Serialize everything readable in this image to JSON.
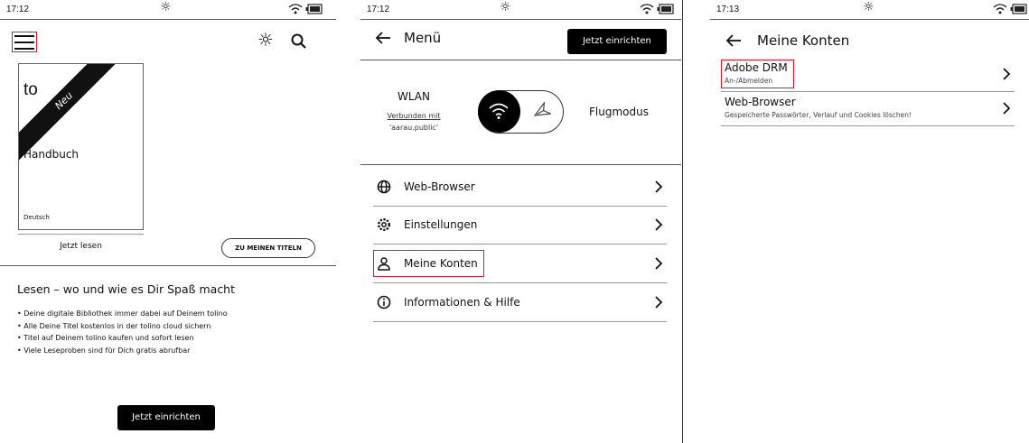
{
  "screens": [
    {
      "status": {
        "time": "17:12"
      },
      "home": {
        "book": {
          "brand": "to",
          "badge": "Neu",
          "title": "Handbuch",
          "language": "Deutsch"
        },
        "read_now": "Jetzt lesen",
        "my_titles_button": "ZU MEINEN TITELN",
        "heading": "Lesen – wo und wie es Dir Spaß macht",
        "bullets": [
          "Deine digitale Bibliothek immer dabei auf Deinem tolino",
          "Alle Deine Titel kostenlos in der tolino cloud sichern",
          "Titel auf Deinem tolino kaufen und sofort lesen",
          "Viele Leseproben sind für Dich gratis abrufbar"
        ],
        "setup_button": "Jetzt einrichten"
      }
    },
    {
      "status": {
        "time": "17:12"
      },
      "menu": {
        "title": "Menü",
        "setup_button": "Jetzt einrichten",
        "wlan": {
          "title": "WLAN",
          "status": "Verbunden mit",
          "ssid": "'aarau.public'"
        },
        "flight_mode": "Flugmodus",
        "items": [
          {
            "label": "Web-Browser",
            "icon": "globe-icon"
          },
          {
            "label": "Einstellungen",
            "icon": "gear-icon"
          },
          {
            "label": "Meine Konten",
            "icon": "user-icon"
          },
          {
            "label": "Informationen & Hilfe",
            "icon": "info-icon"
          }
        ]
      }
    },
    {
      "status": {
        "time": "17:13"
      },
      "accounts": {
        "title": "Meine Konten",
        "items": [
          {
            "title": "Adobe DRM",
            "subtitle": "An-/Abmelden"
          },
          {
            "title": "Web-Browser",
            "subtitle": "Gespeicherte Passwörter, Verlauf und Cookies löschen!"
          }
        ]
      }
    }
  ],
  "highlight_color": "#d9182d"
}
